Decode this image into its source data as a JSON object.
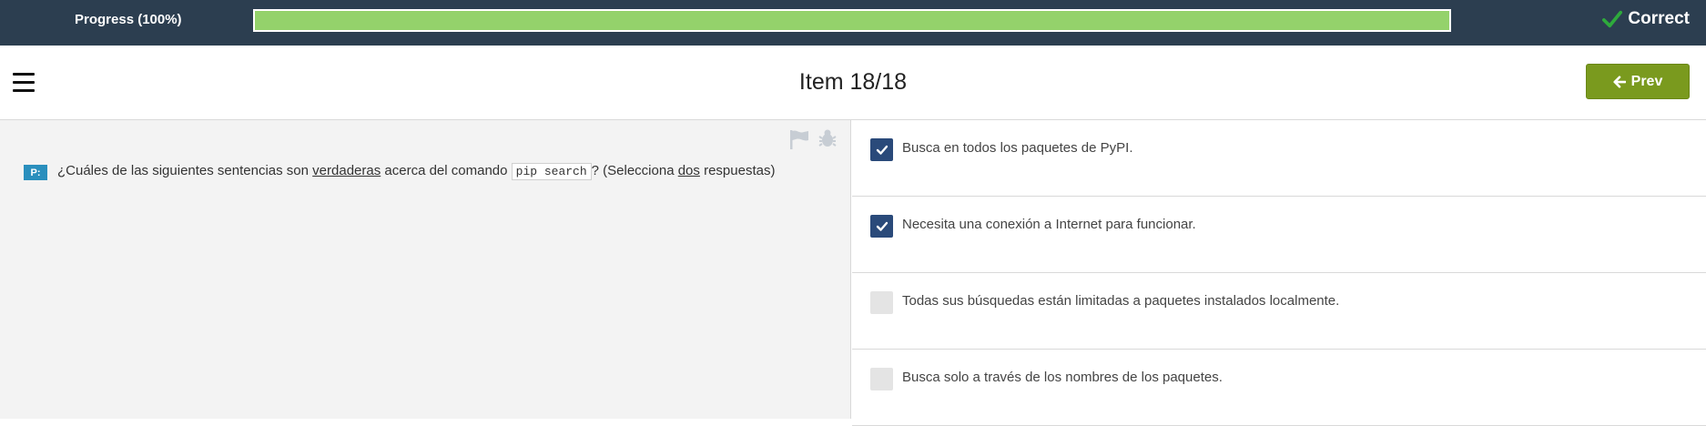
{
  "progress": {
    "label": "Progress (100%)",
    "fraction": 1.0,
    "fill_color": "#94d26b"
  },
  "status": {
    "text": "Correct",
    "icon": "check-icon",
    "icon_color": "#2eaa3c"
  },
  "header": {
    "title": "Item 18/18",
    "prev_label": "Prev",
    "prev_icon": "arrow-left-icon",
    "menu_icon": "hamburger-menu-icon"
  },
  "question": {
    "badge": "P:",
    "parts": {
      "p1": "¿Cuáles de las siguientes sentencias son ",
      "u1": "verdaderas",
      "p2": " acerca del comando ",
      "code": "pip search",
      "p3": "? (Selecciona ",
      "u2": "dos",
      "p4": " respuestas)"
    },
    "tools": [
      "flag-icon",
      "bug-icon"
    ]
  },
  "answers": [
    {
      "text": "Busca en todos los paquetes de PyPI.",
      "checked": true
    },
    {
      "text": "Necesita una conexión a Internet para funcionar.",
      "checked": true
    },
    {
      "text": "Todas sus búsquedas están limitadas a paquetes instalados localmente.",
      "checked": false
    },
    {
      "text": "Busca solo a través de los nombres de los paquetes.",
      "checked": false
    }
  ],
  "colors": {
    "topbar": "#2c3e50",
    "prev_button": "#7a9a1e",
    "checkbox_checked": "#2a4a7a",
    "badge": "#2a8fbd"
  }
}
